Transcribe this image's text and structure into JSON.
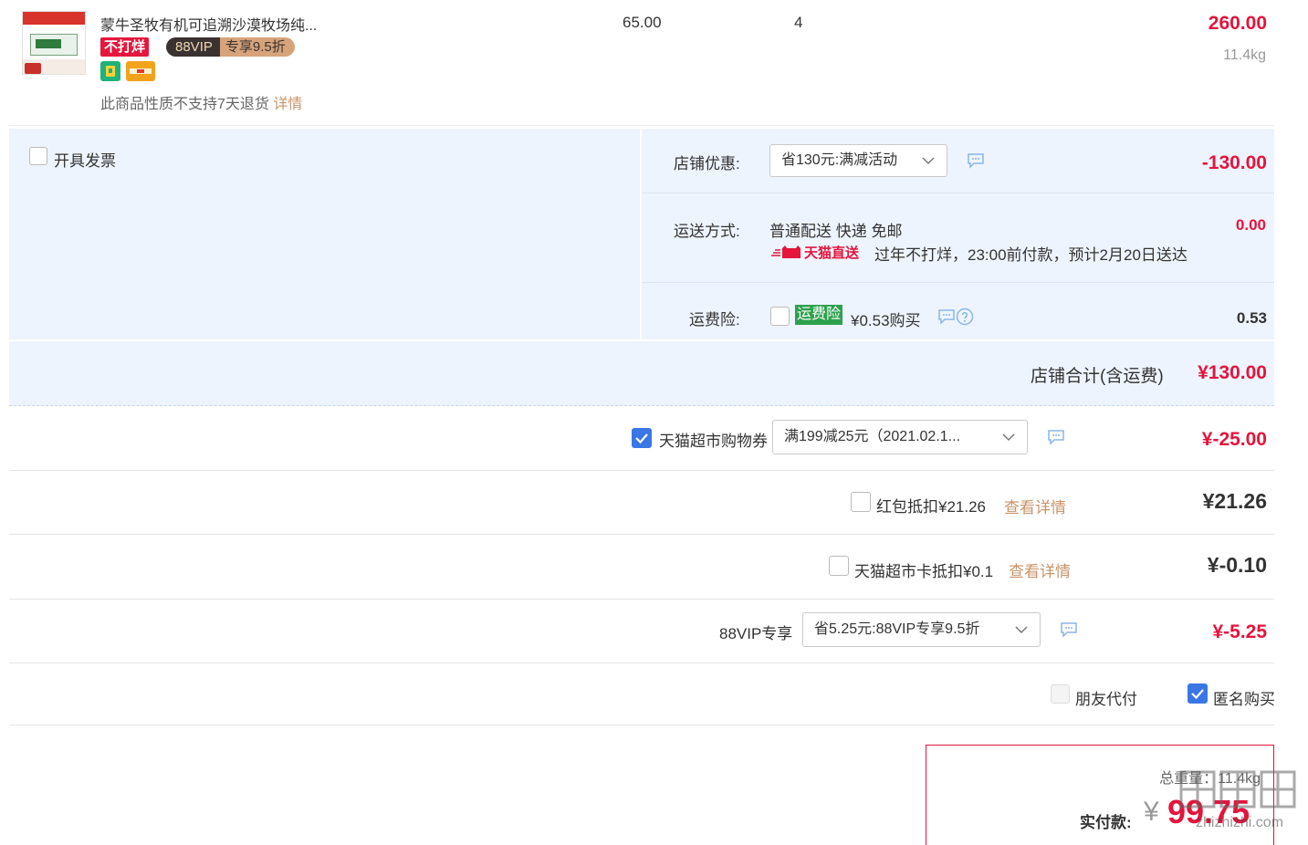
{
  "product": {
    "title": "蒙牛圣牧有机可追溯沙漠牧场纯...",
    "price": "65.00",
    "quantity": "4",
    "subtotal": "260.00",
    "weight": "11.4kg",
    "badge_buyao": "不打烊",
    "badge_vip_left": "88VIP",
    "badge_vip_right": "专享9.5折",
    "return_note": "此商品性质不支持7天退货",
    "return_link": "详情"
  },
  "invoice": {
    "label": "开具发票",
    "checked": false
  },
  "store_discount": {
    "label": "店铺优惠:",
    "selected": "省130元:满减活动",
    "amount": "-130.00"
  },
  "shipping": {
    "label": "运送方式:",
    "method": "普通配送 快递 免邮",
    "tmall_direct": "天猫直送",
    "note": "过年不打烊，23:00前付款，预计2月20日送达",
    "amount": "0.00"
  },
  "insurance": {
    "label": "运费险:",
    "tag": "运费险",
    "text": "¥0.53购买",
    "amount": "0.53",
    "checked": false
  },
  "store_total": {
    "label": "店铺合计(含运费)",
    "amount": "¥130.00"
  },
  "coupon": {
    "label": "天猫超市购物券",
    "checked": true,
    "selected": "满199减25元（2021.02.1...",
    "amount": "¥-25.00"
  },
  "red_packet": {
    "label": "红包抵扣¥21.26",
    "link": "查看详情",
    "amount": "¥21.26",
    "checked": false
  },
  "market_card": {
    "label": "天猫超市卡抵扣¥0.1",
    "link": "查看详情",
    "amount": "¥-0.10",
    "checked": false
  },
  "vip": {
    "label": "88VIP专享",
    "selected": "省5.25元:88VIP专享9.5折",
    "amount": "¥-5.25"
  },
  "options": {
    "friend_pay": "朋友代付",
    "anonymous": "匿名购买",
    "anonymous_checked": true
  },
  "summary": {
    "weight_label": "总重量：11.4kg",
    "pay_label": "实付款:",
    "currency": "¥",
    "amount": "99.75"
  },
  "watermark": "zhizhizhi.com",
  "colors": {
    "accent_red": "#e4143c",
    "panel_bg": "#eef4fd",
    "check_blue": "#3a76e6",
    "link_tan": "#c8946a"
  }
}
